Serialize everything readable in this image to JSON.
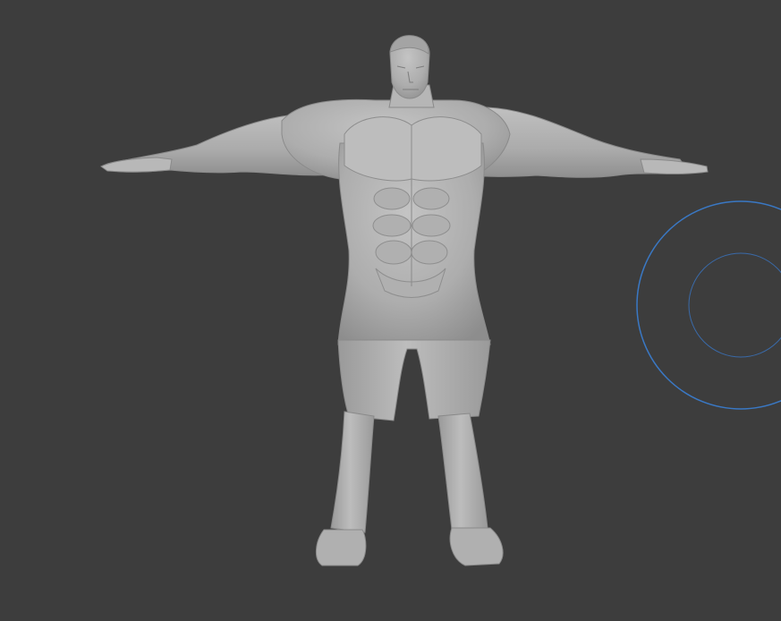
{
  "viewport": {
    "background": "#3d3d3d",
    "model_color": "#b4b4b4",
    "brush_color": "#3a78c4"
  },
  "objects": {
    "model": "sculpted-humanoid-tpose",
    "brush_cursor": "sculpt-brush-radius-cursor"
  }
}
